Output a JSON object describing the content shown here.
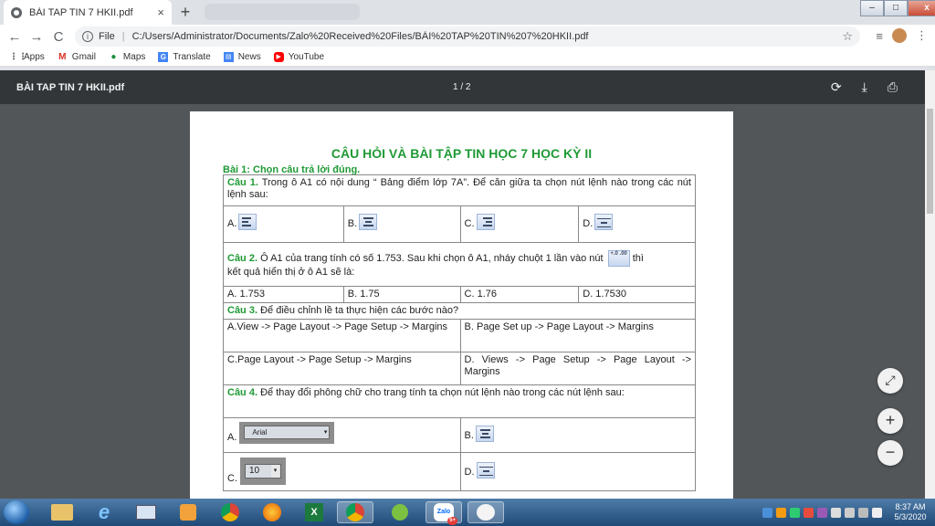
{
  "browser": {
    "tab_title": "BÀI TAP TIN 7 HKII.pdf",
    "tab_close": "×",
    "new_tab": "+",
    "window_controls": {
      "minimize": "–",
      "maximize": "□",
      "close": "x"
    },
    "nav": {
      "back": "←",
      "forward": "→",
      "reload": "C"
    },
    "address": {
      "info": "i",
      "scheme": "File",
      "url": "C:/Users/Administrator/Documents/Zalo%20Received%20Files/BÀI%20TAP%20TIN%207%20HKII.pdf"
    },
    "toolbar_icons": [
      "star-icon",
      "reading-list-icon",
      "profile-avatar",
      "menu-icon"
    ],
    "bookmarks": [
      {
        "label": "Apps",
        "icon": "apps-grid-icon",
        "color": "#5f6368"
      },
      {
        "label": "Gmail",
        "icon": "gmail-icon",
        "color": "#d93025"
      },
      {
        "label": "Maps",
        "icon": "maps-pin-icon",
        "color": "#1e8e3e"
      },
      {
        "label": "Translate",
        "icon": "translate-icon",
        "color": "#4285f4"
      },
      {
        "label": "News",
        "icon": "news-icon",
        "color": "#4285f4"
      },
      {
        "label": "YouTube",
        "icon": "youtube-icon",
        "color": "#ff0000"
      }
    ]
  },
  "pdf": {
    "filename": "BÀI TAP TIN 7 HKII.pdf",
    "page_indicator": "1 / 2",
    "actions": {
      "rotate": "⟳",
      "download": "⤓",
      "print": "⎙"
    },
    "zoom": {
      "fit": "⤢",
      "in": "+",
      "out": "−"
    }
  },
  "document": {
    "title": "CÂU HỎI VÀ BÀI TẬP TIN HỌC 7 HỌC KỲ II",
    "section": "Bài 1: Chọn câu trả lời đúng.",
    "q1": {
      "num": "Câu 1.",
      "text": "Trong ô A1 có nội dung “ Bảng điểm lớp 7A”. Để căn giữa ta chọn nút lệnh nào trong các nút lệnh sau:",
      "options": [
        {
          "label": "A.",
          "icon": "align-left-icon"
        },
        {
          "label": "B.",
          "icon": "align-center-icon"
        },
        {
          "label": "C.",
          "icon": "align-right-icon"
        },
        {
          "label": "D.",
          "icon": "merge-center-icon"
        }
      ]
    },
    "q2": {
      "num": "Câu 2.",
      "text_before": "Ô A1 của trang tính có số 1.753. Sau khi chọn ô A1, nháy chuột 1 lần vào nút",
      "text_after": "thì",
      "text_line2": "kết quả hiển thị ở ô A1 sẽ là:",
      "icon": "increase-decimal-icon",
      "icon_text": "+.0 .00",
      "options": [
        "A. 1.753",
        "B. 1.75",
        "C. 1.76",
        "D. 1.7530"
      ]
    },
    "q3": {
      "num": "Câu 3.",
      "text": "Để điều chỉnh lề ta thực hiện các bước nào?",
      "options": [
        "A.View -> Page Layout -> Page Setup -> Margins",
        "B. Page Set up -> Page Layout -> Margins",
        "C.Page Layout -> Page Setup -> Margins",
        "D. Views -> Page Setup -> Page Layout -> Margins"
      ]
    },
    "q4": {
      "num": "Câu 4.",
      "text": "Để thay đổi phông chữ cho trang tính ta chọn nút lệnh nào trong các nút lệnh sau:",
      "options": [
        {
          "label": "A.",
          "icon": "font-name-box-icon",
          "value": "Arial"
        },
        {
          "label": "B.",
          "icon": "align-center-icon"
        },
        {
          "label": "C.",
          "icon": "font-size-box-icon",
          "value": "10"
        },
        {
          "label": "D.",
          "icon": "merge-center-icon"
        }
      ]
    }
  },
  "taskbar": {
    "apps": [
      "start-button",
      "file-explorer-icon",
      "internet-explorer-icon",
      "screen-icon",
      "media-player-icon",
      "chrome-icon",
      "firefox-icon",
      "excel-icon",
      "chrome-active-icon",
      "app-icon",
      "zalo-icon",
      "paint-icon"
    ],
    "zalo_label": "Zalo",
    "zalo_badge": "5+",
    "excel_label": "X",
    "time": "8:37 AM",
    "date": "5/3/2020"
  }
}
